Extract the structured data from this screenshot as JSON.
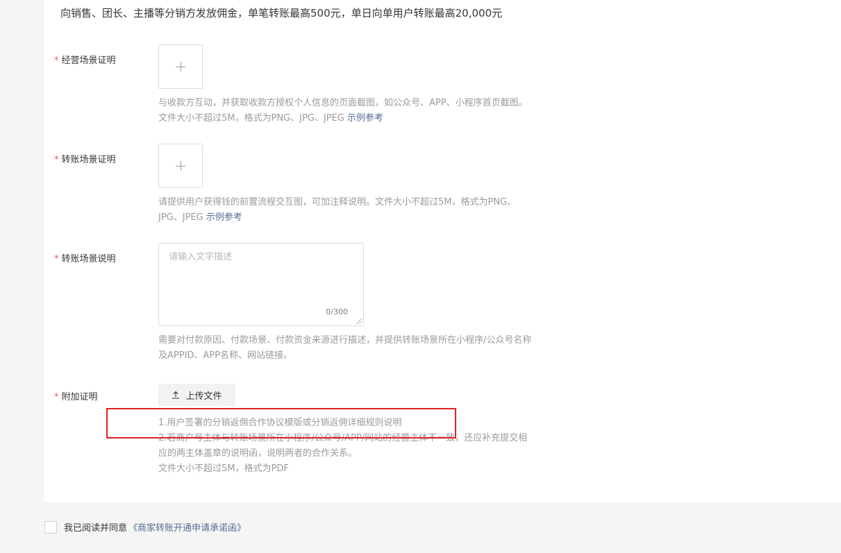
{
  "intro_text": "向销售、团长、主播等分销方发放佣金，单笔转账最高500元，单日向单用户转账最高20,000元",
  "required_mark": "*",
  "fields": {
    "business_scene": {
      "label": "经营场景证明",
      "hint": "与收款方互动，并获取收款方授权个人信息的页面截图，如公众号、APP、小程序首页截图。文件大小不超过5M，格式为PNG、JPG、JPEG",
      "example_link": "示例参考"
    },
    "transfer_scene_proof": {
      "label": "转账场景证明",
      "hint": "请提供用户获得钱的前置流程交互图，可加注释说明。文件大小不超过5M，格式为PNG、JPG、JPEG",
      "example_link": "示例参考"
    },
    "transfer_scene_desc": {
      "label": "转账场景说明",
      "placeholder": "请输入文字描述",
      "counter": "0/300",
      "hint": "需要对付款原因、付款场景、付款资金来源进行描述，并提供转账场景所在小程序/公众号名称及APPID、APP名称、网站链接。"
    },
    "attachment": {
      "label": "附加证明",
      "button_label": "上传文件",
      "hint_line1": "1.用户签署的分销返佣合作协议模版或分销返佣详细规则说明",
      "hint_line2": "2.若商户号主体与转账场景所在小程序/公众号/APP/网站的经营主体不一致，还应补充提交相应的两主体盖章的说明函，说明两者的合作关系。",
      "hint_line3": "文件大小不超过5M，格式为PDF"
    }
  },
  "agreement": {
    "text": "我已阅读并同意",
    "link": "《商家转账开通申请承诺函》",
    "checked": false
  },
  "icons": {
    "add": "plus-icon",
    "upload": "upload-arrow-icon"
  },
  "colors": {
    "link": "#576b95",
    "required": "#fa5151",
    "highlight_box": "#e02020",
    "hint_text": "#9a9a9a"
  }
}
